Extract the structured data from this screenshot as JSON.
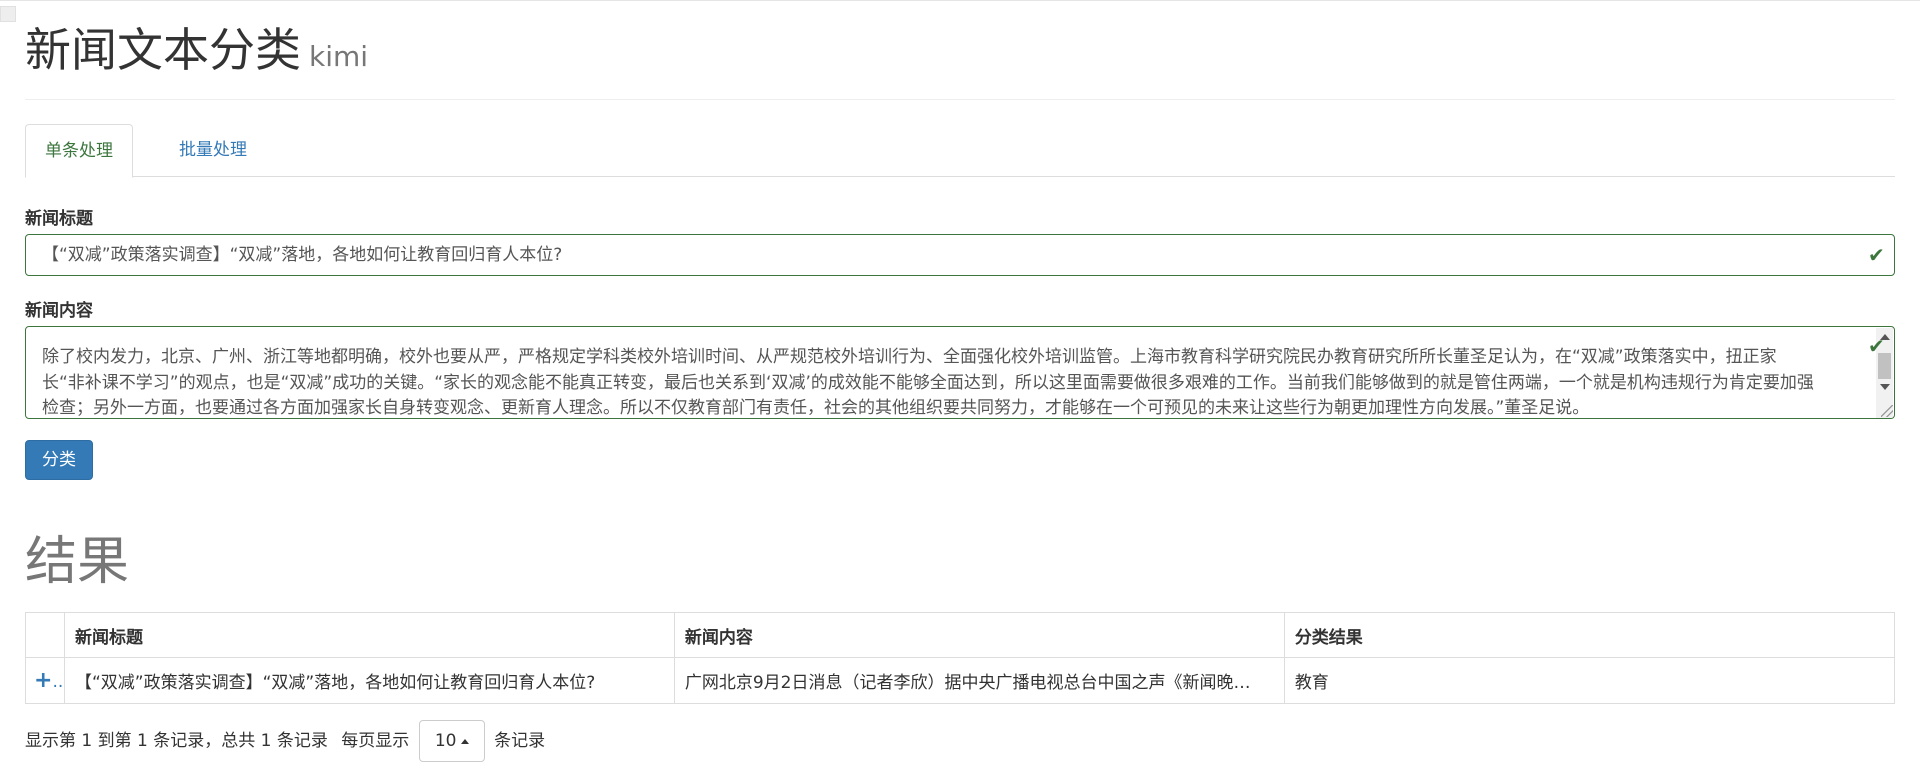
{
  "page": {
    "title": "新闻文本分类",
    "subtitle": "kimi"
  },
  "tabs": [
    {
      "label": "单条处理",
      "active": true
    },
    {
      "label": "批量处理",
      "active": false
    }
  ],
  "form": {
    "title_label": "新闻标题",
    "title_value": "【“双减”政策落实调查】“双减”落地，各地如何让教育回归育人本位?",
    "content_label": "新闻内容",
    "content_value": "除了校内发力，北京、广州、浙江等地都明确，校外也要从严，严格规定学科类校外培训时间、从严规范校外培训行为、全面强化校外培训监管。上海市教育科学研究院民办教育研究所所长董圣足认为，在“双减”政策落实中，扭正家长“非补课不学习”的观点，也是“双减”成功的关键。“家长的观念能不能真正转变，最后也关系到‘双减’的成效能不能够全面达到，所以这里面需要做很多艰难的工作。当前我们能够做到的就是管住两端，一个就是机构违规行为肯定要加强检查；另外一方面，也要通过各方面加强家长自身转变观念、更新育人理念。所以不仅教育部门有责任，社会的其他组织要共同努力，才能够在一个可预见的未来让这些行为朝更加理性方向发展。”董圣足说。",
    "submit_label": "分类",
    "valid_color": "#3c763d",
    "icons": {
      "valid": "check-icon"
    }
  },
  "results": {
    "heading": "结果",
    "columns": [
      "新闻标题",
      "新闻内容",
      "分类结果"
    ],
    "rows": [
      {
        "title": "【“双减”政策落实调查】“双减”落地，各地如何让教育回归育人本位?",
        "content": "广网北京9月2日消息（记者李欣）据中央广播电视总台中国之声《新闻晚…",
        "category": "教育"
      }
    ],
    "pagination": {
      "summary": "显示第 1 到第 1 条记录，总共 1 条记录",
      "per_page_prefix": "每页显示",
      "page_size": "10",
      "per_page_suffix": "条记录"
    }
  },
  "colors": {
    "primary": "#337ab7",
    "success": "#3c763d",
    "muted": "#777777"
  }
}
